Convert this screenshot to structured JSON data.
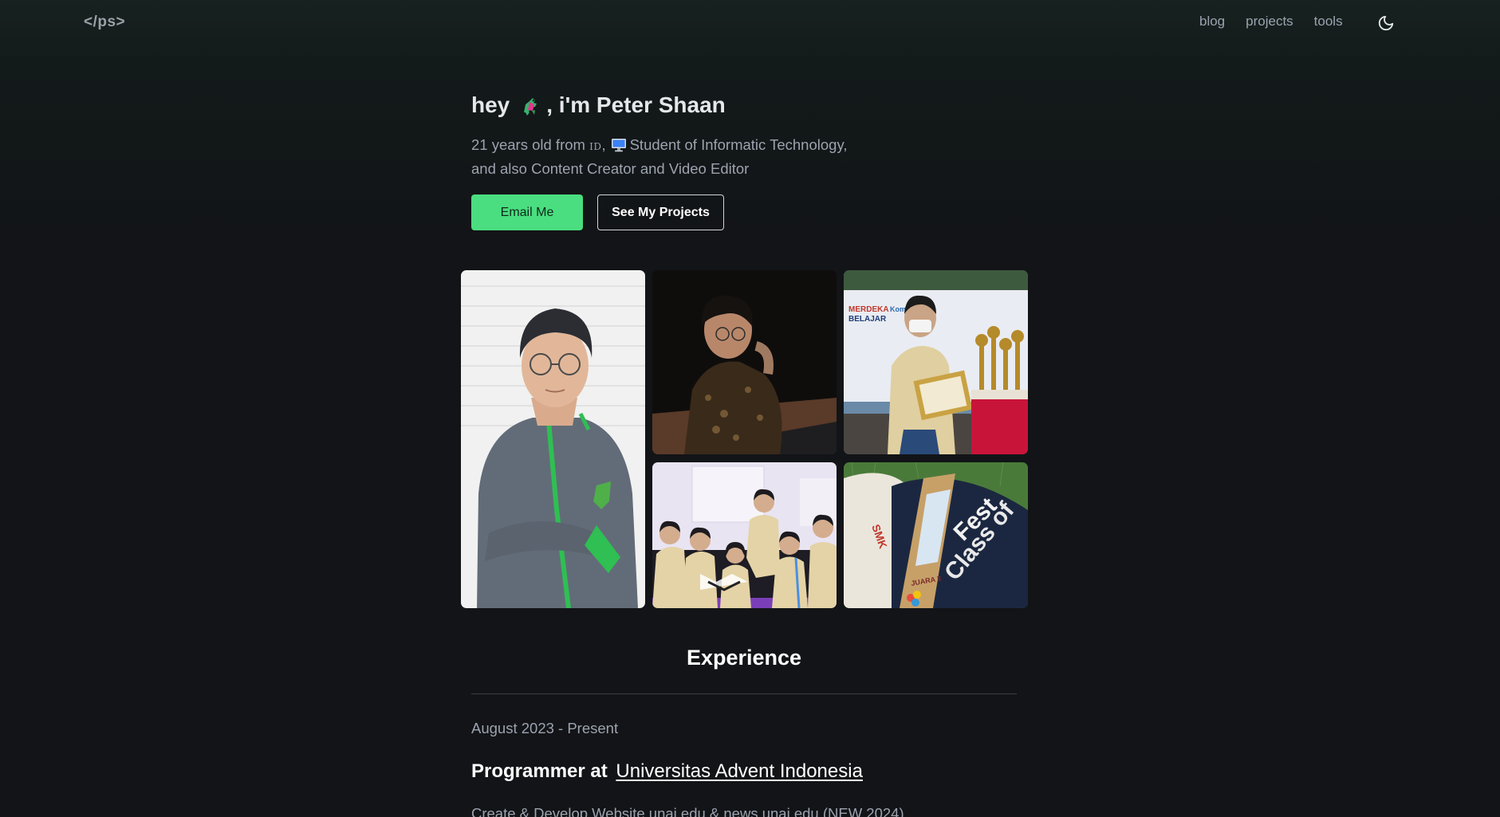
{
  "nav": {
    "logo": "</ps>",
    "links": [
      {
        "label": "blog"
      },
      {
        "label": "projects"
      },
      {
        "label": "tools"
      }
    ],
    "theme_icon": "moon-icon"
  },
  "hero": {
    "greeting_prefix": "hey",
    "greeting_emoji": "dragon-emoji",
    "greeting_suffix": ", i'm Peter Shaan",
    "subtitle_part1": "21 years old from",
    "country_flag": "ID",
    "subtitle_part2": ",",
    "computer_icon": "desktop-computer-emoji",
    "subtitle_part3": "Student of Informatic Technology, and also Content Creator and Video Editor",
    "email_button": "Email Me",
    "projects_button": "See My Projects"
  },
  "gallery": {
    "photos": [
      {
        "name": "portrait-photo"
      },
      {
        "name": "laptop-work-photo"
      },
      {
        "name": "award-certificate-photo"
      },
      {
        "name": "group-photo"
      },
      {
        "name": "trophy-photo"
      }
    ]
  },
  "experience": {
    "title": "Experience",
    "items": [
      {
        "date": "August 2023 - Present",
        "role": "Programmer at",
        "organization": "Universitas Advent Indonesia",
        "description": "Create & Develop Website unai.edu & news.unai.edu (NEW 2024)"
      }
    ]
  },
  "colors": {
    "background": "#121417",
    "accent": "#4ade80",
    "muted_text": "#9ca3af"
  }
}
